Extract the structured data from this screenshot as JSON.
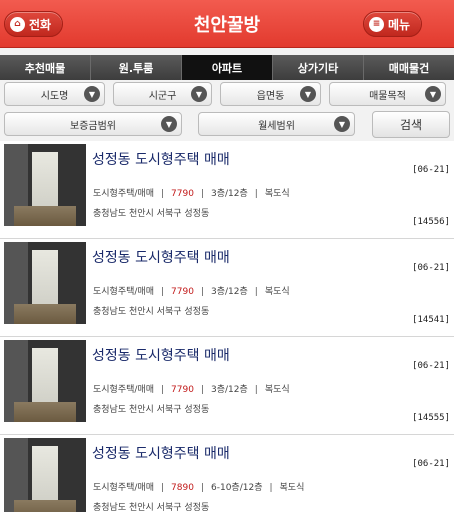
{
  "header": {
    "title": "천안꿀방",
    "call_label": "전화",
    "menu_label": "메뉴",
    "accent": "#e23a2e"
  },
  "tabs": [
    {
      "label": "추천매물"
    },
    {
      "label": "원.투룸"
    },
    {
      "label": "아파트",
      "active": true
    },
    {
      "label": "상가기타"
    },
    {
      "label": "매매물건"
    }
  ],
  "filters": {
    "sido": "시도명",
    "sigungu": "시군구",
    "eupmyeondong": "읍면동",
    "purpose": "매물목적",
    "deposit": "보증금범위",
    "monthly": "월세범위",
    "search": "검색"
  },
  "listings": [
    {
      "title": "성정동 도시형주택 매매",
      "date": "[06-21]",
      "type": "도시형주택/매매",
      "price": "7790",
      "floor": "3층/12층",
      "structure": "복도식",
      "address": "충청남도 천안시 서북구 성정동",
      "id": "[14556]"
    },
    {
      "title": "성정동 도시형주택 매매",
      "date": "[06-21]",
      "type": "도시형주택/매매",
      "price": "7790",
      "floor": "3층/12층",
      "structure": "복도식",
      "address": "충청남도 천안시 서북구 성정동",
      "id": "[14541]"
    },
    {
      "title": "성정동 도시형주택 매매",
      "date": "[06-21]",
      "type": "도시형주택/매매",
      "price": "7790",
      "floor": "3층/12층",
      "structure": "복도식",
      "address": "충청남도 천안시 서북구 성정동",
      "id": "[14555]"
    },
    {
      "title": "성정동 도시형주택 매매",
      "date": "[06-21]",
      "type": "도시형주택/매매",
      "price": "7890",
      "floor": "6-10층/12층",
      "structure": "복도식",
      "address": "충청남도 천안시 서북구 성정동",
      "id": ""
    }
  ]
}
